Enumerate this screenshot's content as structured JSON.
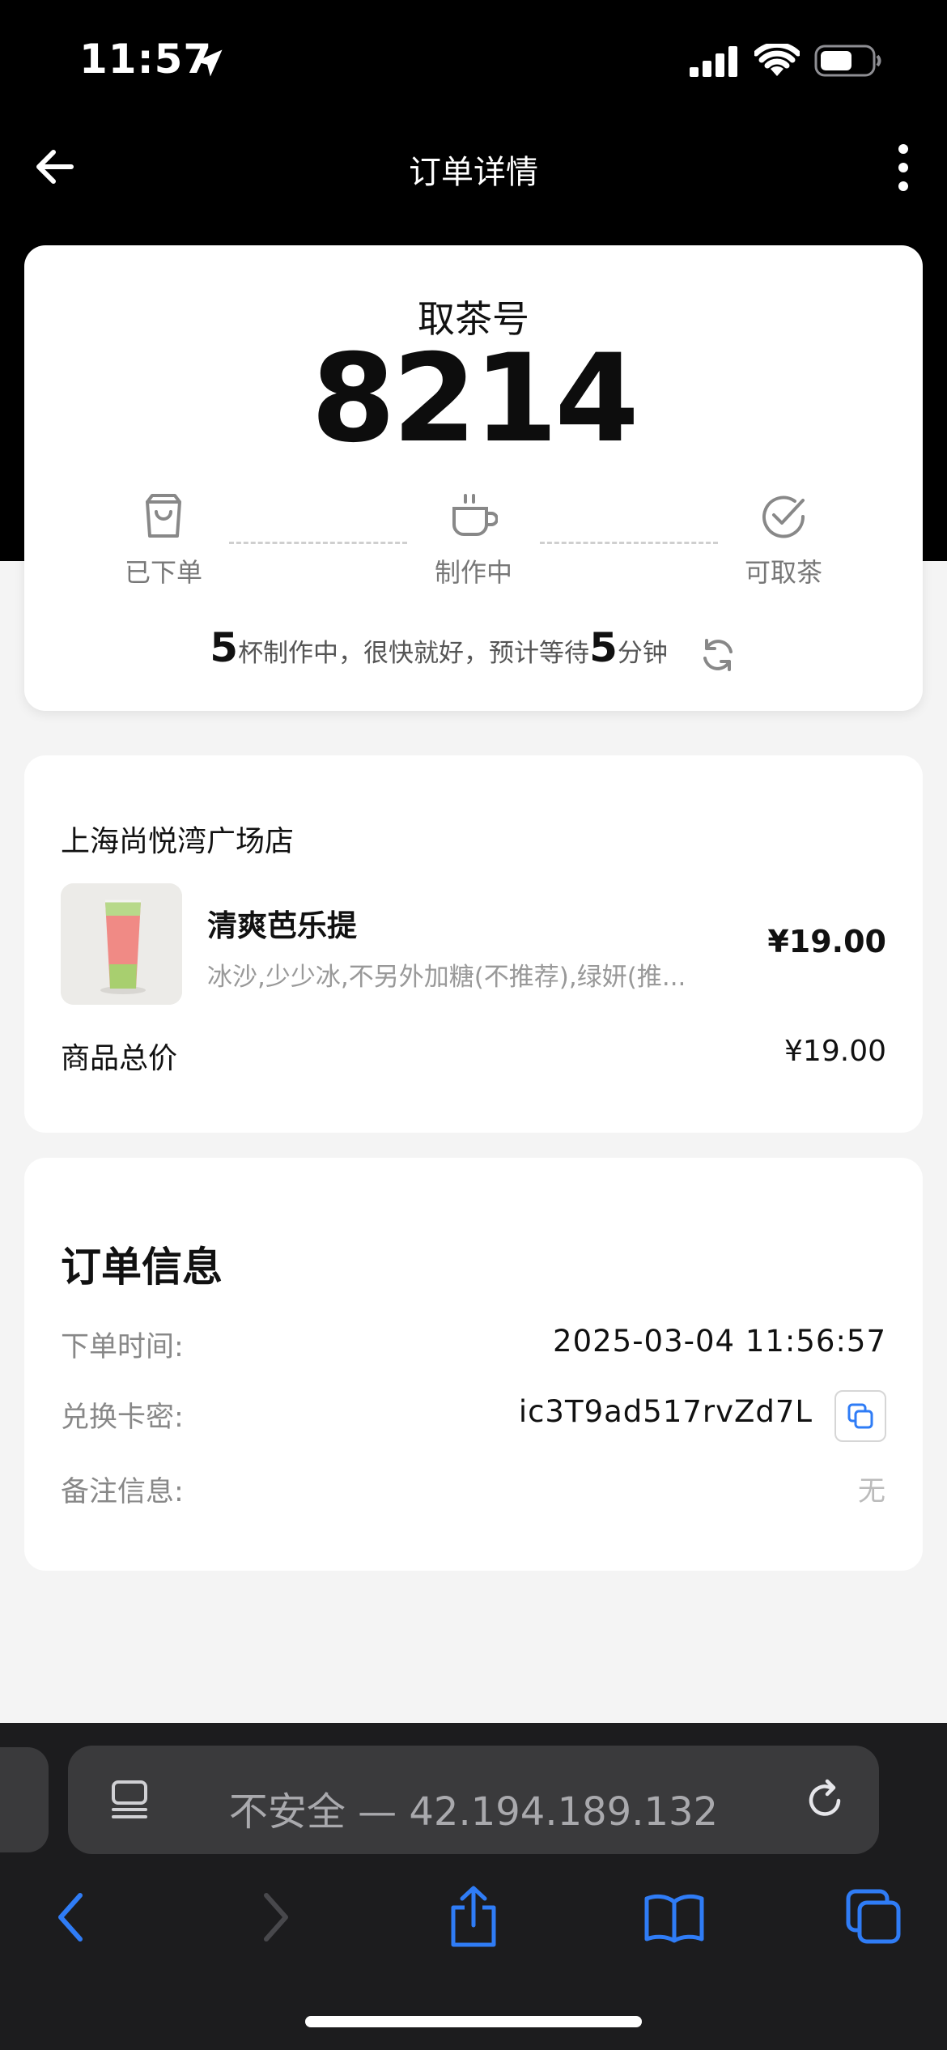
{
  "status_bar": {
    "time": "11:57"
  },
  "nav": {
    "title": "订单详情"
  },
  "pickup": {
    "label": "取茶号",
    "number": "8214",
    "steps": [
      {
        "label": "已下单",
        "icon": "bag-icon"
      },
      {
        "label": "制作中",
        "icon": "cup-icon"
      },
      {
        "label": "可取茶",
        "icon": "check-circle-icon"
      }
    ],
    "wait": {
      "cups": "5",
      "text_1": "杯制作中，很快就好，预计等待",
      "minutes": "5",
      "text_2": "分钟"
    }
  },
  "order": {
    "store_name": "上海尚悦湾广场店",
    "item": {
      "name": "清爽芭乐提",
      "spec": "冰沙,少少冰,不另外加糖(不推荐),绿妍(推...",
      "price": "¥19.00"
    },
    "total_label": "商品总价",
    "total_value": "¥19.00"
  },
  "order_info": {
    "title": "订单信息",
    "rows": [
      {
        "label": "下单时间:",
        "value": "2025-03-04 11:56:57"
      },
      {
        "label": "兑换卡密:",
        "value": "ic3T9ad517rvZd7L"
      },
      {
        "label": "备注信息:",
        "value": "无"
      }
    ]
  },
  "browser": {
    "url_text": "不安全 — 42.194.189.132"
  },
  "colors": {
    "header_bg": "#000000",
    "page_bg": "#f4f4f4",
    "accent_blue": "#2f7cf6",
    "copy_icon": "#2f7cf6"
  }
}
